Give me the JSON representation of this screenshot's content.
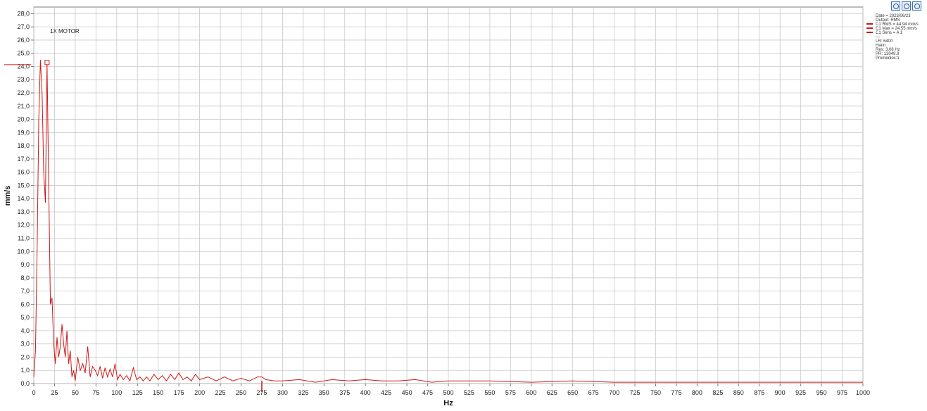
{
  "chart_data": {
    "type": "line",
    "title": "1X MOTOR",
    "xlabel": "Hz",
    "ylabel": "mm/s",
    "xlim": [
      0,
      1000
    ],
    "ylim": [
      0,
      28.5
    ],
    "x_ticks": [
      0,
      25,
      50,
      75,
      100,
      125,
      150,
      175,
      200,
      225,
      250,
      275,
      300,
      325,
      350,
      375,
      400,
      425,
      450,
      475,
      500,
      525,
      550,
      575,
      600,
      625,
      650,
      675,
      700,
      725,
      750,
      775,
      800,
      825,
      850,
      875,
      900,
      925,
      950,
      975,
      1000
    ],
    "y_ticks": [
      0,
      1,
      2,
      3,
      4,
      5,
      6,
      7,
      8,
      9,
      10,
      11,
      12,
      13,
      14,
      15,
      16,
      17,
      18,
      19,
      20,
      21,
      22,
      23,
      24,
      25,
      26,
      27,
      28
    ],
    "y_tick_labels": [
      "0,0",
      "1,0",
      "2,0",
      "3,0",
      "4,0",
      "5,0",
      "6,0",
      "7,0",
      "8,0",
      "9,0",
      "10,0",
      "11,0",
      "12,0",
      "13,0",
      "14,0",
      "15,0",
      "16,0",
      "17,0",
      "18,0",
      "19,0",
      "20,0",
      "21,0",
      "22,0",
      "23,0",
      "24,0",
      "25,0",
      "26,0",
      "27,0",
      "28,0"
    ],
    "grid": true,
    "series": [
      {
        "color": "#d01818",
        "x": [
          0,
          2,
          4,
          6,
          8,
          10,
          12,
          14,
          16,
          18,
          20,
          22,
          24,
          26,
          28,
          30,
          32,
          34,
          36,
          38,
          40,
          42,
          44,
          46,
          48,
          50,
          53,
          56,
          59,
          62,
          65,
          68,
          71,
          74,
          77,
          80,
          83,
          86,
          89,
          92,
          95,
          98,
          101,
          104,
          108,
          112,
          116,
          120,
          124,
          128,
          132,
          136,
          140,
          145,
          150,
          155,
          160,
          165,
          170,
          175,
          180,
          185,
          190,
          195,
          200,
          210,
          220,
          230,
          240,
          250,
          260,
          270,
          275,
          280,
          290,
          300,
          320,
          340,
          360,
          380,
          400,
          420,
          440,
          460,
          480,
          500,
          550,
          600,
          650,
          700,
          750,
          800,
          850,
          900,
          950,
          1000
        ],
        "y": [
          0.5,
          2.5,
          10.0,
          20.0,
          24.5,
          22.0,
          16.0,
          13.7,
          24.3,
          15.0,
          6.0,
          6.5,
          3.0,
          1.5,
          3.5,
          2.0,
          2.8,
          4.5,
          3.0,
          2.0,
          4.0,
          1.5,
          2.5,
          0.5,
          1.0,
          0.2,
          2.0,
          1.0,
          1.5,
          0.8,
          2.8,
          0.5,
          1.3,
          1.0,
          0.6,
          1.3,
          0.4,
          1.2,
          0.5,
          1.1,
          0.5,
          1.5,
          0.3,
          0.7,
          0.3,
          0.6,
          0.2,
          1.2,
          0.3,
          0.5,
          0.2,
          0.5,
          0.2,
          0.7,
          0.3,
          0.6,
          0.2,
          0.7,
          0.3,
          0.8,
          0.3,
          0.5,
          0.2,
          0.7,
          0.3,
          0.5,
          0.2,
          0.5,
          0.2,
          0.4,
          0.2,
          0.5,
          0.5,
          0.3,
          0.2,
          0.2,
          0.3,
          0.1,
          0.3,
          0.2,
          0.3,
          0.2,
          0.2,
          0.3,
          0.1,
          0.2,
          0.2,
          0.1,
          0.2,
          0.1,
          0.1,
          0.1,
          0.1,
          0.1,
          0.1,
          0.1
        ]
      }
    ],
    "marker": {
      "x": 16,
      "y": 24.3
    },
    "cursor_x": 275,
    "legend": {
      "header_lines": [
        "Date = 2023/06/23",
        "Output: RMS"
      ],
      "entries": [
        "C1 RMS = 44.94 mm/s",
        "C1 Max = 24.55 mm/s",
        "C1 Sens = A 1"
      ],
      "info_lines": [
        "—",
        "LR: 6400",
        "Hann",
        "Res: 3,06 Hz",
        "PR: 13049.0",
        "Promedios:1"
      ]
    }
  },
  "toolbar": {
    "buttons": [
      "zoom-in",
      "zoom-fit",
      "zoom-out"
    ]
  },
  "colors": {
    "series": "#d01818",
    "grid": "#c8c8c8",
    "axis": "#7a7a7a"
  }
}
